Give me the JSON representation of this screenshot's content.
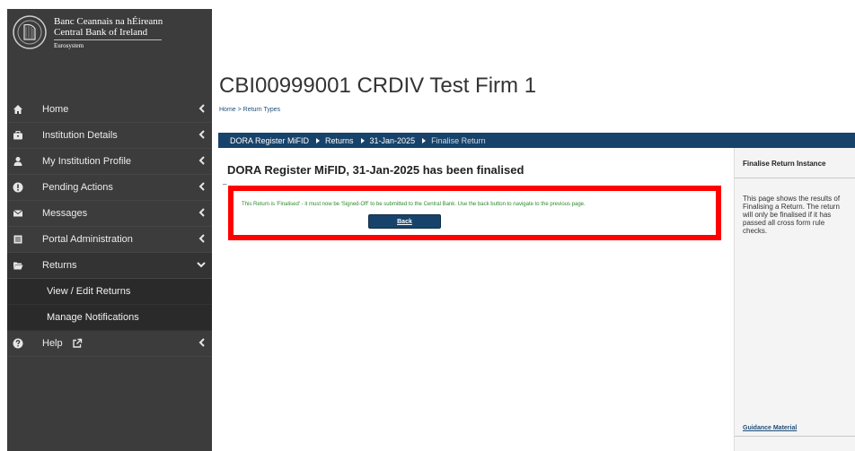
{
  "logo": {
    "line1": "Banc Ceannais na hÉireann",
    "line2": "Central Bank of Ireland",
    "line3": "Eurosystem"
  },
  "sidebar": {
    "items": [
      {
        "label": "Home",
        "icon": "home-icon"
      },
      {
        "label": "Institution Details",
        "icon": "briefcase-icon"
      },
      {
        "label": "My Institution Profile",
        "icon": "user-icon"
      },
      {
        "label": "Pending Actions",
        "icon": "exclamation-icon"
      },
      {
        "label": "Messages",
        "icon": "envelope-icon"
      },
      {
        "label": "Portal Administration",
        "icon": "list-icon"
      },
      {
        "label": "Returns",
        "icon": "folder-open-icon"
      },
      {
        "label": "Help",
        "icon": "question-icon"
      }
    ],
    "returns_sub": [
      "View / Edit Returns",
      "Manage Notifications"
    ]
  },
  "page": {
    "title": "CBI00999001 CRDIV Test Firm 1",
    "breadcrumb": "Home > Return Types"
  },
  "nav_bar": {
    "seg1": "DORA Register MiFID",
    "seg2": "Returns",
    "seg3": "31-Jan-2025",
    "seg4": "Finalise Return"
  },
  "main": {
    "heading": "DORA Register MiFID, 31-Jan-2025 has been finalised",
    "dash": "–",
    "message": "This Return is 'Finalised' - it must now be 'Signed-Off' to be submitted to the Central Bank. Use the back button to navigate to the previous page.",
    "back_label": "Back"
  },
  "right_panel": {
    "title": "Finalise Return Instance",
    "body_lines": [
      "This page shows the results of",
      "Finalising a Return. The return",
      "will only be finalised if it has",
      "passed all cross form rule",
      "checks."
    ],
    "guidance": "Guidance Material"
  },
  "colors": {
    "sidebar_bg": "#3c3c3c",
    "nav_bar_bg": "#17436b",
    "alert_border": "#ff0000",
    "message_text": "#2e8b2e"
  }
}
